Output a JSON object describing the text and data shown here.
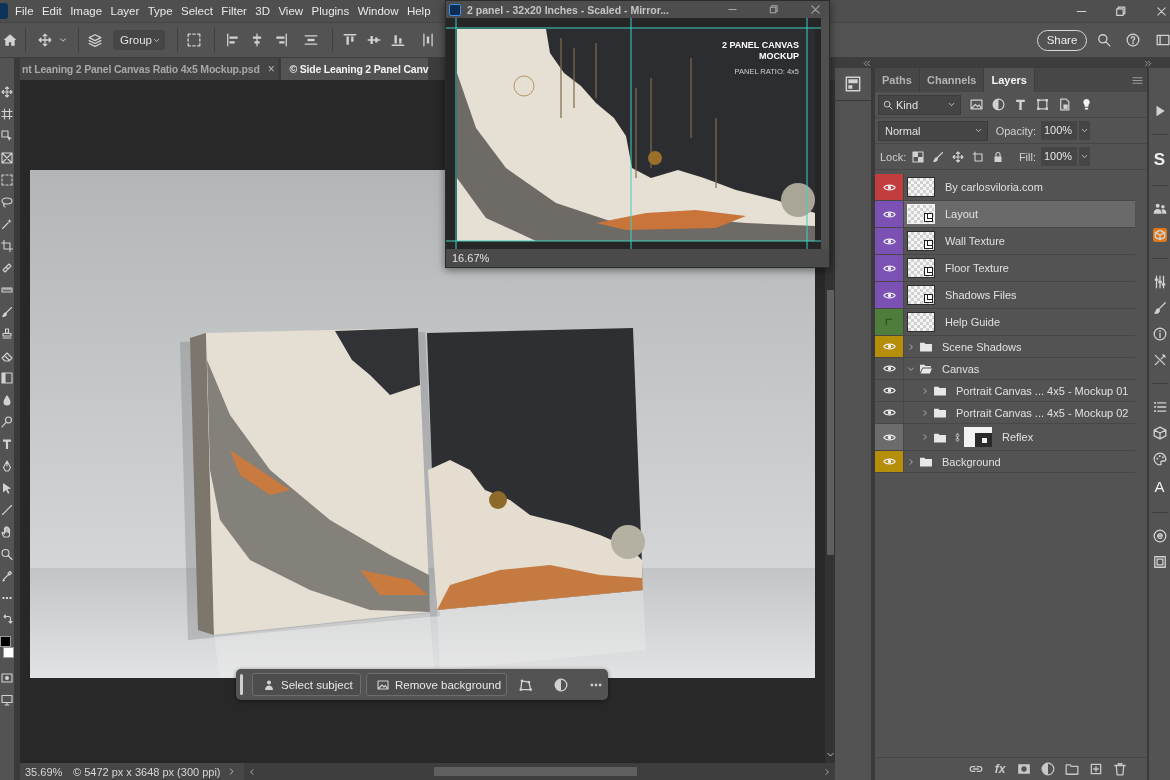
{
  "menu_bar": {
    "items": [
      "File",
      "Edit",
      "Image",
      "Layer",
      "Type",
      "Select",
      "Filter",
      "3D",
      "View",
      "Plugins",
      "Window",
      "Help"
    ]
  },
  "options_bar": {
    "layer_select": "Group",
    "share_button": "Share"
  },
  "document_tabs": [
    {
      "label": "nt Leaning 2 Panel Canvas Ratio 4x5 Mockup.psd",
      "close": "×",
      "selected": false
    },
    {
      "label": "© Side Leaning 2 Panel Canv",
      "selected": true
    }
  ],
  "floating_window": {
    "title": "2 panel - 32x20 Inches - Scaled - Mirror...",
    "document_heading": [
      "2 PANEL CANVAS",
      "MOCKUP"
    ],
    "document_subheading": "PANEL RATIO: 4x5",
    "zoom": "16.67%"
  },
  "contextual_taskbar": {
    "buttons": [
      {
        "label": "Select subject",
        "kind": "subject"
      },
      {
        "label": "Remove background",
        "kind": "background"
      }
    ]
  },
  "status_bar": {
    "zoom": "35.69%",
    "document_info": "© 5472 px x 3648 px (300 ppi)"
  },
  "layers_panel": {
    "tabs": [
      {
        "label": "Paths",
        "selected": false
      },
      {
        "label": "Channels",
        "selected": false
      },
      {
        "label": "Layers",
        "selected": true
      }
    ],
    "filter_kind": "Kind",
    "blend_mode": "Normal",
    "opacity_label": "Opacity:",
    "opacity": "100%",
    "lock_label": "Lock:",
    "fill_label": "Fill:",
    "fill": "100%",
    "layers": [
      {
        "name": "By carlosviloria.com",
        "kind": "pixel",
        "color": "#c23e3e",
        "visible": true,
        "selected": false,
        "masked": false
      },
      {
        "name": "Layout",
        "kind": "smart",
        "color": "#7b51b4",
        "visible": true,
        "selected": true,
        "masked": false
      },
      {
        "name": "Wall Texture",
        "kind": "smart",
        "color": "#7b51b4",
        "visible": true,
        "selected": false,
        "masked": false
      },
      {
        "name": "Floor Texture",
        "kind": "smart",
        "color": "#7b51b4",
        "visible": true,
        "selected": false,
        "masked": false
      },
      {
        "name": "Shadows Files",
        "kind": "smart",
        "color": "#7b51b4",
        "visible": true,
        "selected": false,
        "masked": false
      },
      {
        "name": "Help Guide",
        "kind": "pixel",
        "color": "#4f7d3b",
        "visible": false,
        "selected": false,
        "masked": false
      },
      {
        "name": "Scene Shadows",
        "kind": "group",
        "color": "#b58f0c",
        "visible": true,
        "selected": false,
        "expanded": false,
        "masked": false
      },
      {
        "name": "Canvas",
        "kind": "group",
        "visible": true,
        "selected": false,
        "expanded": true,
        "masked": false,
        "children": [
          {
            "name": "Portrait Canvas ... 4x5 - Mockup 01",
            "kind": "group",
            "visible": true,
            "selected": false,
            "expanded": false,
            "masked": false
          },
          {
            "name": "Portrait Canvas ... 4x5 - Mockup 02",
            "kind": "group",
            "visible": true,
            "selected": false,
            "expanded": false,
            "masked": false
          },
          {
            "name": "Reflex",
            "kind": "group",
            "color": "#6c6c6c",
            "visible": true,
            "selected": false,
            "expanded": false,
            "masked": true
          }
        ]
      },
      {
        "name": "Background",
        "kind": "group",
        "color": "#b58f0c",
        "visible": true,
        "selected": false,
        "expanded": false,
        "masked": false
      }
    ],
    "effects_button": "fx"
  },
  "side_strip": {
    "labels": [
      "S",
      "A"
    ]
  }
}
